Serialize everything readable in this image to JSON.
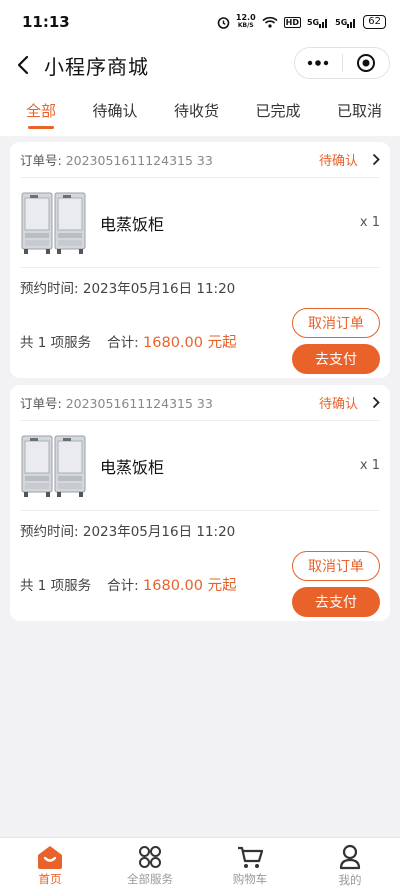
{
  "status_bar": {
    "time": "11:13",
    "net_speed": "12.0",
    "net_unit": "KB/S",
    "hd": "HD",
    "sig1": "5G",
    "sig2": "5G",
    "battery": "62"
  },
  "nav": {
    "title": "小程序商城"
  },
  "tabs": [
    {
      "label": "全部",
      "active": true
    },
    {
      "label": "待确认"
    },
    {
      "label": "待收货"
    },
    {
      "label": "已完成"
    },
    {
      "label": "已取消"
    }
  ],
  "orders": [
    {
      "order_no_label": "订单号:",
      "order_no": "2023051611124315 33",
      "status": "待确认",
      "product_name": "电蒸饭柜",
      "qty": "x 1",
      "time_label": "预约时间:",
      "time": "2023年05月16日 11:20",
      "service_count": "共 1 项服务",
      "total_label": "合计:",
      "total": "1680.00 元起",
      "cancel_label": "取消订单",
      "pay_label": "去支付"
    },
    {
      "order_no_label": "订单号:",
      "order_no": "2023051611124315 33",
      "status": "待确认",
      "product_name": "电蒸饭柜",
      "qty": "x 1",
      "time_label": "预约时间:",
      "time": "2023年05月16日 11:20",
      "service_count": "共 1 项服务",
      "total_label": "合计:",
      "total": "1680.00 元起",
      "cancel_label": "取消订单",
      "pay_label": "去支付"
    }
  ],
  "tabbar": [
    {
      "label": "首页",
      "icon": "home-icon",
      "active": true
    },
    {
      "label": "全部服务",
      "icon": "grid-icon"
    },
    {
      "label": "购物车",
      "icon": "cart-icon"
    },
    {
      "label": "我的",
      "icon": "user-icon"
    }
  ],
  "colors": {
    "accent": "#e8622a",
    "background": "#f2f2f5"
  }
}
